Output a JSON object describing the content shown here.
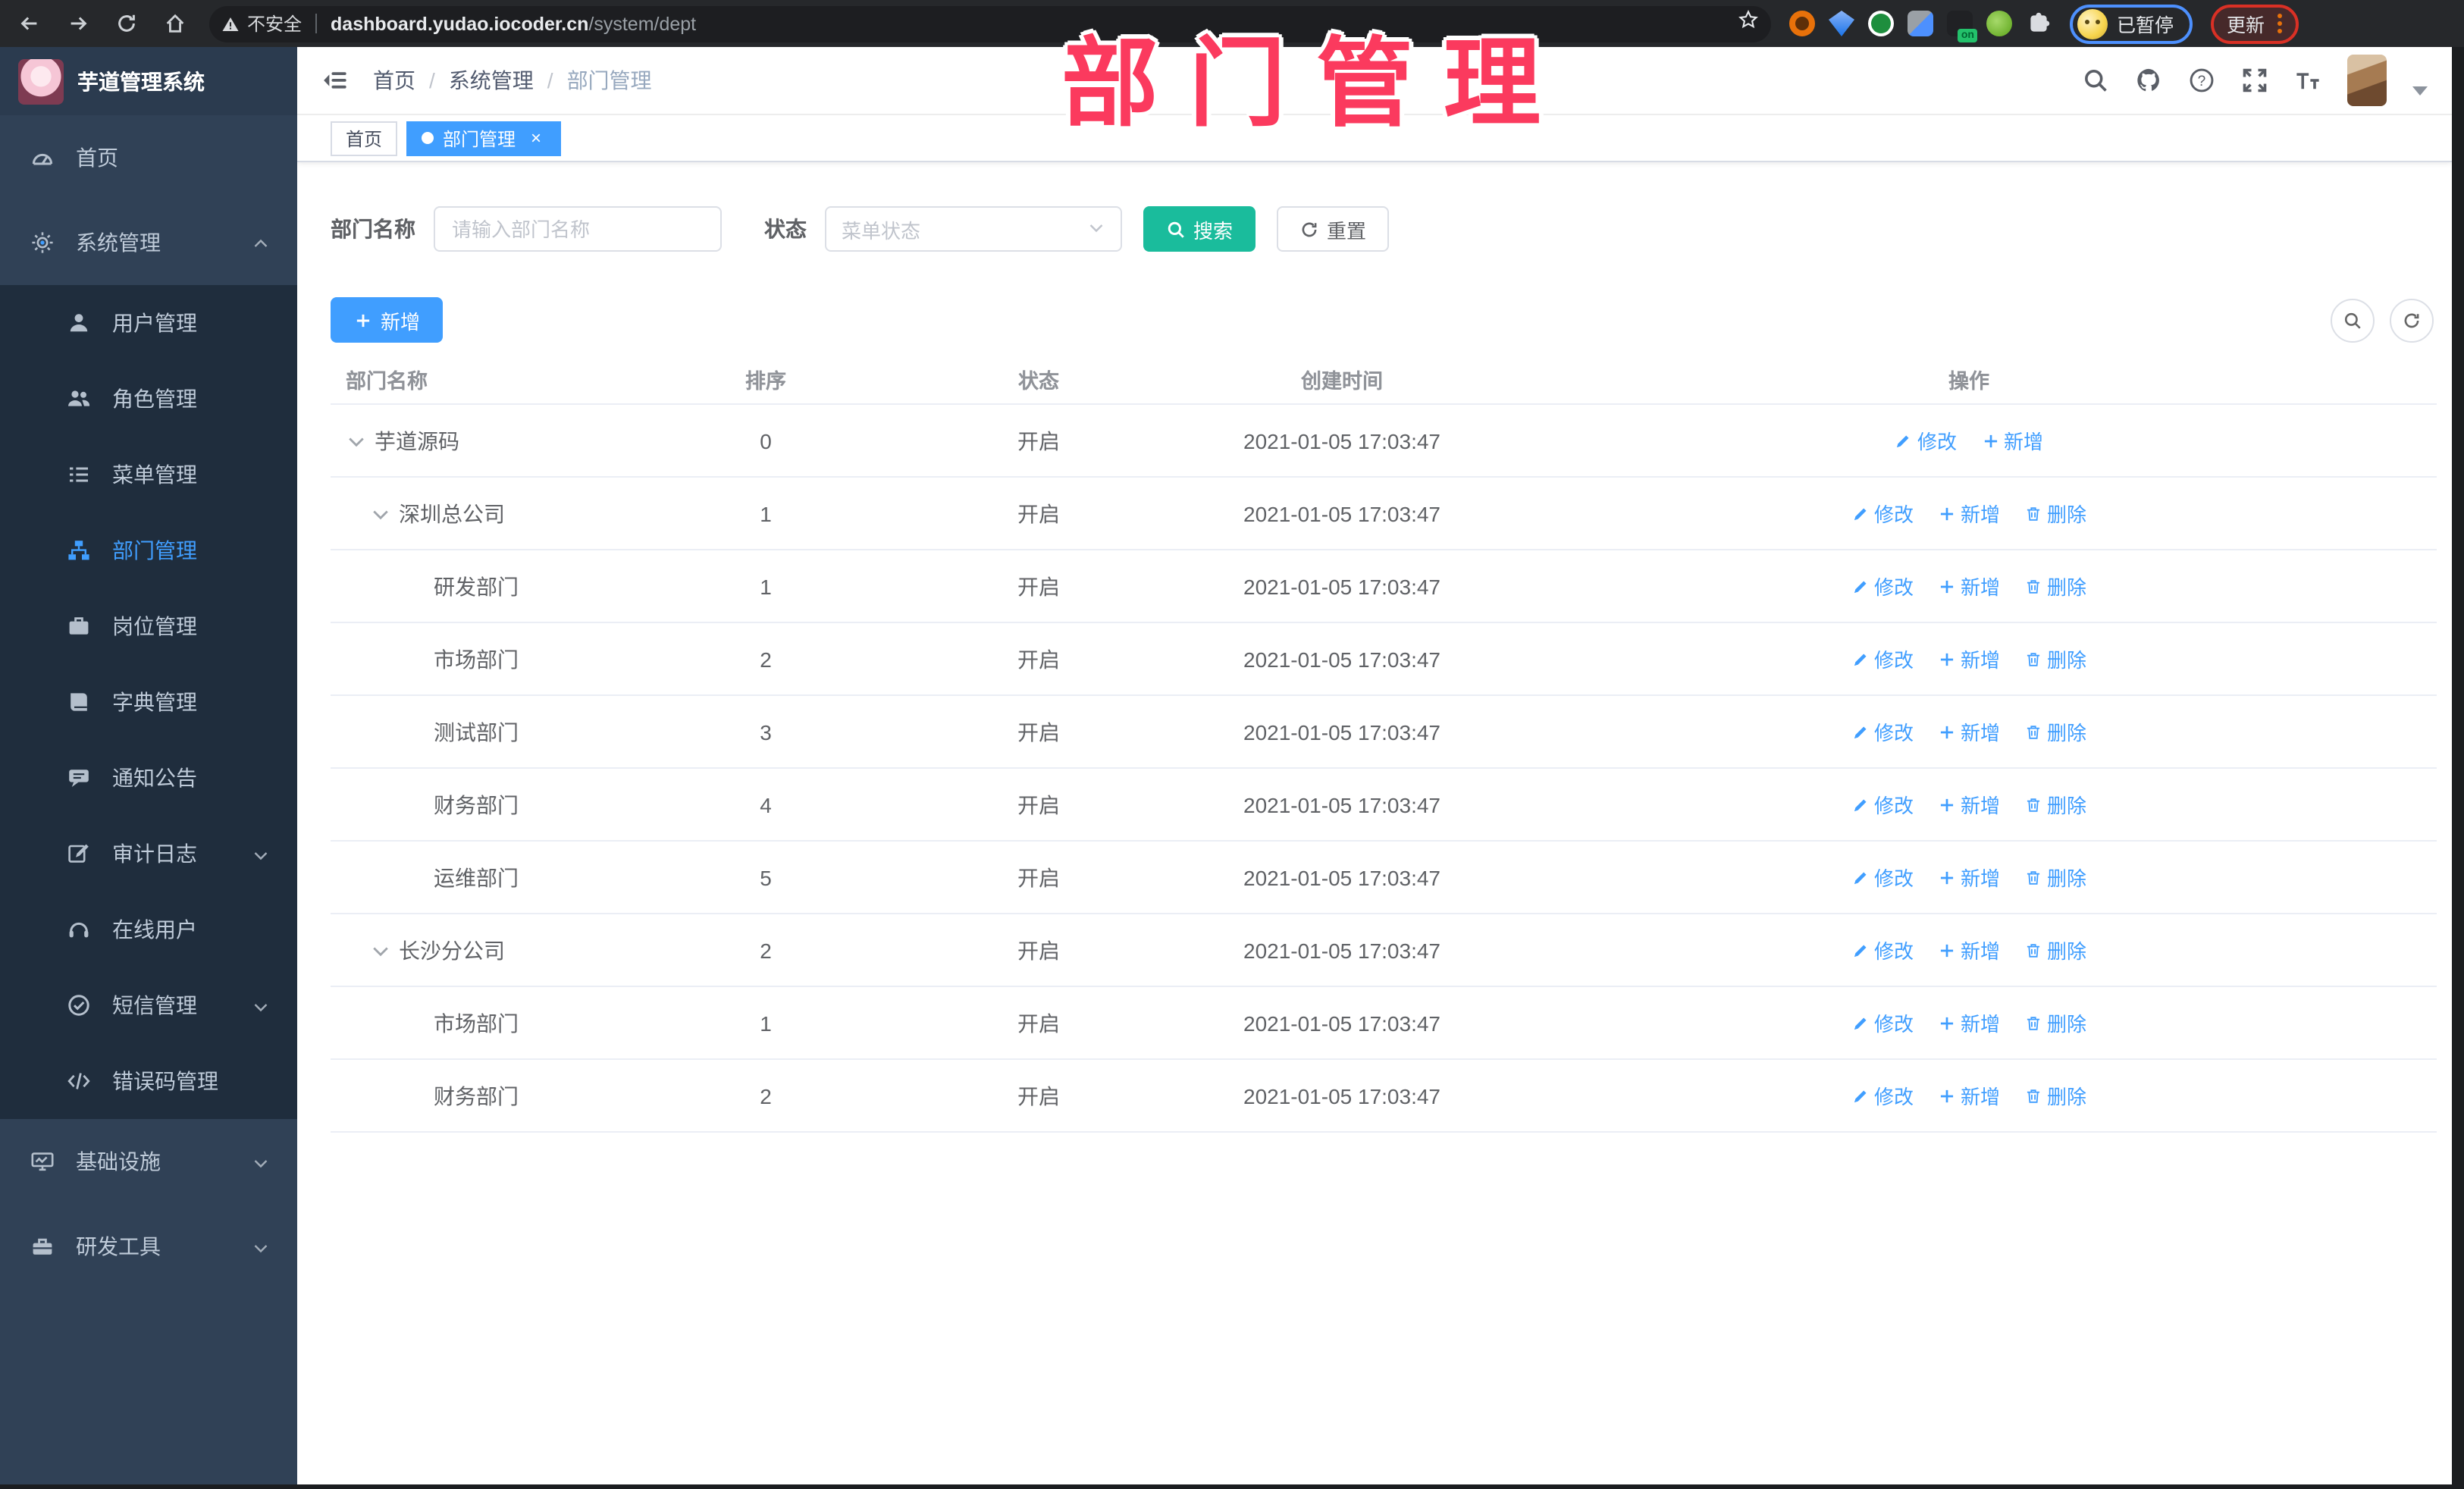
{
  "watermark": {
    "text": "部门管理",
    "color": "#fb3a5e"
  },
  "browser": {
    "security_label": "不安全",
    "url_host": "dashboard.yudao.iocoder.cn",
    "url_path": "/system/dept",
    "extension_on_badge": "on",
    "profile_status": "已暂停",
    "update_label": "更新"
  },
  "app": {
    "title": "芋道管理系统"
  },
  "breadcrumb": {
    "items": [
      "首页",
      "系统管理",
      "部门管理"
    ]
  },
  "tabs": [
    {
      "label": "首页",
      "active": false,
      "closable": false
    },
    {
      "label": "部门管理",
      "active": true,
      "closable": true
    }
  ],
  "filters": {
    "dept_name_label": "部门名称",
    "dept_name_placeholder": "请输入部门名称",
    "status_label": "状态",
    "status_placeholder": "菜单状态",
    "search_label": "搜索",
    "reset_label": "重置"
  },
  "toolbar": {
    "add_label": "新增"
  },
  "table": {
    "columns": [
      "部门名称",
      "排序",
      "状态",
      "创建时间",
      "操作"
    ],
    "action_labels": {
      "edit": "修改",
      "add": "新增",
      "delete": "删除"
    },
    "rows": [
      {
        "name": "芋道源码",
        "level": 0,
        "expandable": true,
        "sort": "0",
        "status": "开启",
        "time": "2021-01-05 17:03:47",
        "actions": [
          "edit",
          "add"
        ]
      },
      {
        "name": "深圳总公司",
        "level": 1,
        "expandable": true,
        "sort": "1",
        "status": "开启",
        "time": "2021-01-05 17:03:47",
        "actions": [
          "edit",
          "add",
          "delete"
        ]
      },
      {
        "name": "研发部门",
        "level": 2,
        "expandable": false,
        "sort": "1",
        "status": "开启",
        "time": "2021-01-05 17:03:47",
        "actions": [
          "edit",
          "add",
          "delete"
        ]
      },
      {
        "name": "市场部门",
        "level": 2,
        "expandable": false,
        "sort": "2",
        "status": "开启",
        "time": "2021-01-05 17:03:47",
        "actions": [
          "edit",
          "add",
          "delete"
        ]
      },
      {
        "name": "测试部门",
        "level": 2,
        "expandable": false,
        "sort": "3",
        "status": "开启",
        "time": "2021-01-05 17:03:47",
        "actions": [
          "edit",
          "add",
          "delete"
        ]
      },
      {
        "name": "财务部门",
        "level": 2,
        "expandable": false,
        "sort": "4",
        "status": "开启",
        "time": "2021-01-05 17:03:47",
        "actions": [
          "edit",
          "add",
          "delete"
        ]
      },
      {
        "name": "运维部门",
        "level": 2,
        "expandable": false,
        "sort": "5",
        "status": "开启",
        "time": "2021-01-05 17:03:47",
        "actions": [
          "edit",
          "add",
          "delete"
        ]
      },
      {
        "name": "长沙分公司",
        "level": 1,
        "expandable": true,
        "sort": "2",
        "status": "开启",
        "time": "2021-01-05 17:03:47",
        "actions": [
          "edit",
          "add",
          "delete"
        ]
      },
      {
        "name": "市场部门",
        "level": 2,
        "expandable": false,
        "sort": "1",
        "status": "开启",
        "time": "2021-01-05 17:03:47",
        "actions": [
          "edit",
          "add",
          "delete"
        ]
      },
      {
        "name": "财务部门",
        "level": 2,
        "expandable": false,
        "sort": "2",
        "status": "开启",
        "time": "2021-01-05 17:03:47",
        "actions": [
          "edit",
          "add",
          "delete"
        ]
      }
    ]
  },
  "sidebar": {
    "items": [
      {
        "label": "首页",
        "icon": "dashboard-icon",
        "type": "top"
      },
      {
        "label": "系统管理",
        "icon": "gear-icon",
        "type": "top",
        "arrow": "up"
      },
      {
        "label": "用户管理",
        "icon": "user-icon",
        "type": "sub"
      },
      {
        "label": "角色管理",
        "icon": "users-icon",
        "type": "sub"
      },
      {
        "label": "菜单管理",
        "icon": "menu-list-icon",
        "type": "sub"
      },
      {
        "label": "部门管理",
        "icon": "org-tree-icon",
        "type": "sub",
        "active": true
      },
      {
        "label": "岗位管理",
        "icon": "briefcase-icon",
        "type": "sub"
      },
      {
        "label": "字典管理",
        "icon": "book-icon",
        "type": "sub"
      },
      {
        "label": "通知公告",
        "icon": "megaphone-icon",
        "type": "sub"
      },
      {
        "label": "审计日志",
        "icon": "edit-icon",
        "type": "sub",
        "arrow": "down"
      },
      {
        "label": "在线用户",
        "icon": "headset-icon",
        "type": "sub"
      },
      {
        "label": "短信管理",
        "icon": "message-check-icon",
        "type": "sub",
        "arrow": "down"
      },
      {
        "label": "错误码管理",
        "icon": "code-icon",
        "type": "sub"
      },
      {
        "label": "基础设施",
        "icon": "monitor-icon",
        "type": "top",
        "arrow": "down"
      },
      {
        "label": "研发工具",
        "icon": "toolbox-icon",
        "type": "top",
        "arrow": "down"
      }
    ]
  },
  "colors": {
    "accent_blue": "#409eff",
    "search_teal": "#1abc9c",
    "watermark_pink": "#fb3a5e",
    "sidebar_bg": "#304156",
    "submenu_bg": "#1f2d3d"
  }
}
